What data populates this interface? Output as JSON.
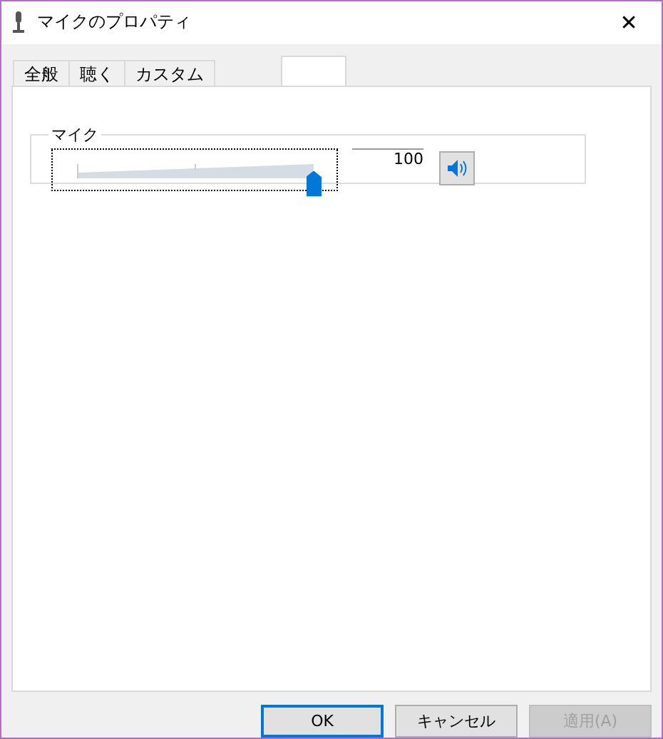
{
  "window": {
    "title": "マイクのプロパティ",
    "close": "✕"
  },
  "tabs": [
    {
      "label": "全般",
      "selected": false
    },
    {
      "label": "聴く",
      "selected": false
    },
    {
      "label": "カスタム",
      "selected": false
    },
    {
      "selected": true
    }
  ],
  "group": {
    "title": "マイク",
    "level": 1,
    "reading": "100",
    "muted": false
  },
  "buttons": [
    {
      "label": "OK",
      "default": true,
      "disabled": false
    },
    {
      "label": "キャンセル",
      "default": false,
      "disabled": false
    },
    {
      "label": "適用(A)",
      "default": false,
      "disabled": true
    }
  ]
}
